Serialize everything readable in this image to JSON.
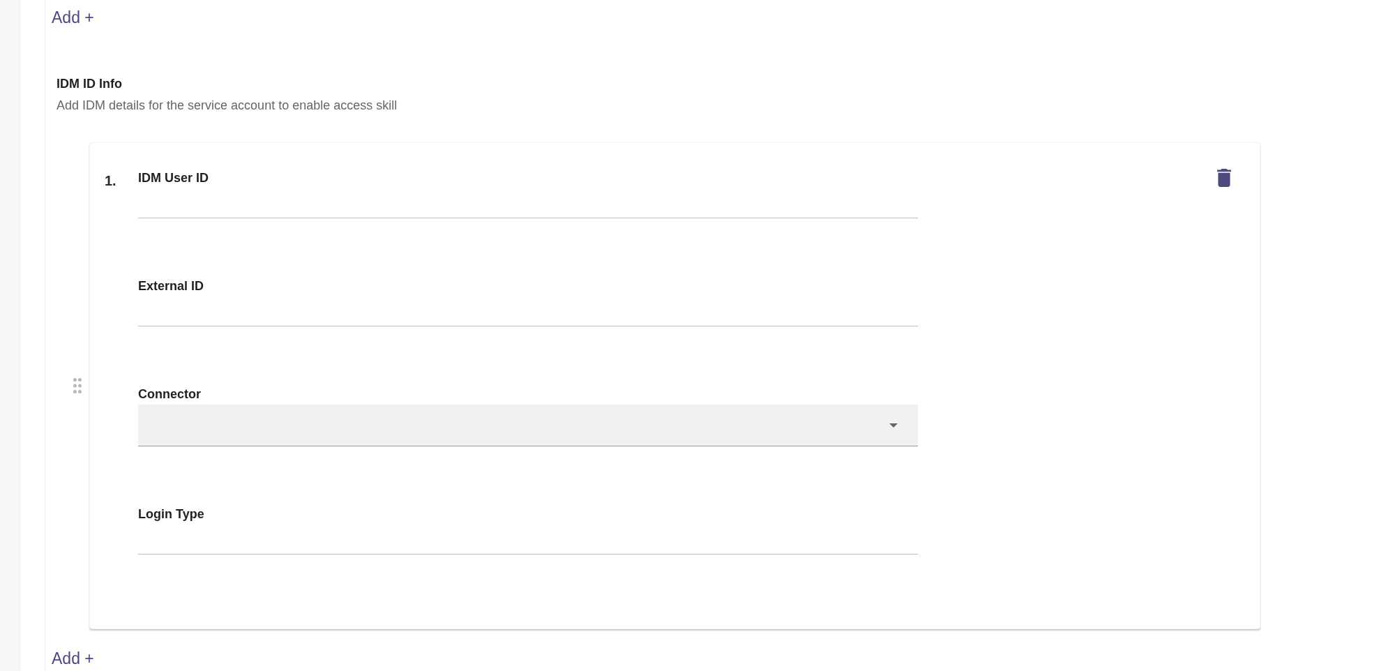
{
  "top_link": {
    "label": "Add +"
  },
  "section": {
    "title": "IDM ID Info",
    "description": "Add IDM details for the service account to enable access skill"
  },
  "entries": [
    {
      "index": "1.",
      "fields": [
        {
          "kind": "text",
          "label": "IDM User ID"
        },
        {
          "kind": "text",
          "label": "External ID"
        },
        {
          "kind": "select",
          "label": "Connector"
        },
        {
          "kind": "text",
          "label": "Login Type"
        }
      ]
    }
  ],
  "bottom_link": {
    "label": "Add +"
  }
}
